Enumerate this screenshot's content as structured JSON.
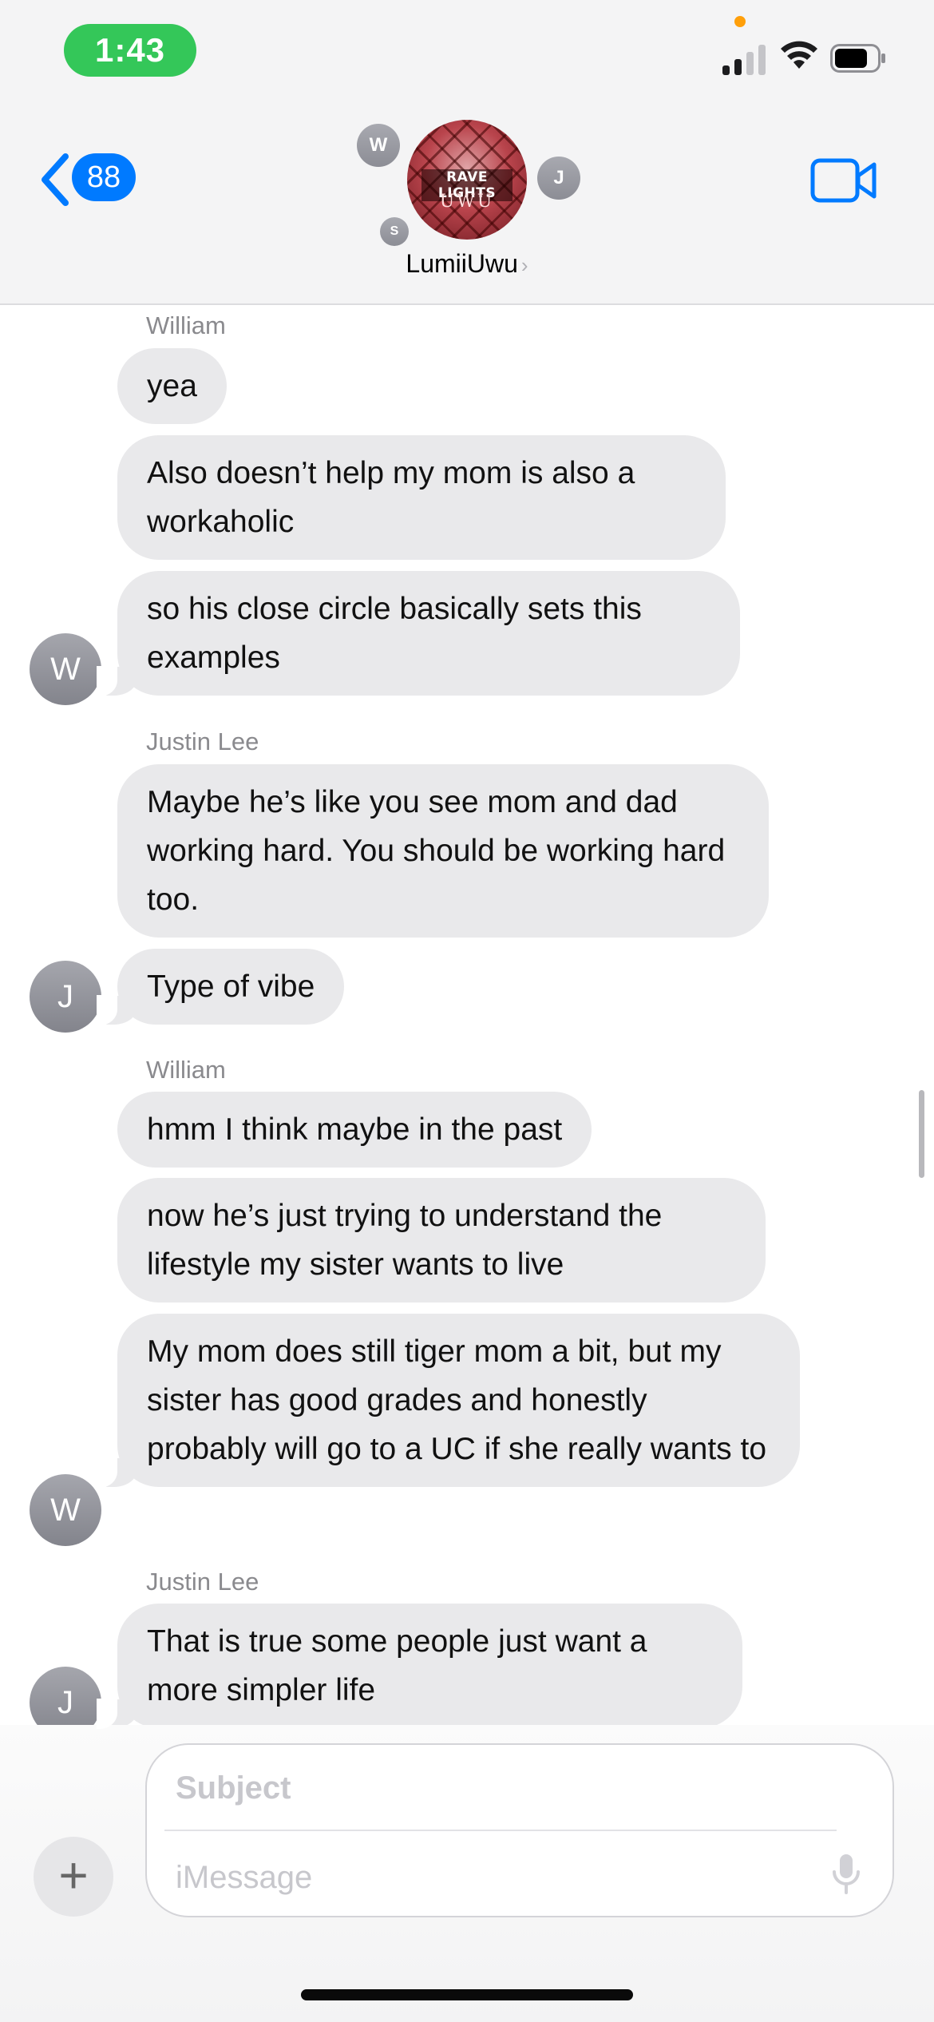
{
  "status_bar": {
    "time": "1:43"
  },
  "header": {
    "back_badge": "88",
    "group_name": "LumiiUwu",
    "group_avatar_text_line1": "RAVE LIGHTS",
    "group_avatar_text_line2": "UWU",
    "member_initials": [
      "W",
      "J",
      "S"
    ]
  },
  "messages": [
    {
      "sender": "William",
      "initial": "W",
      "bubbles": [
        "yea",
        "Also doesn’t help my mom is also a workaholic",
        "so his close circle basically sets this examples"
      ]
    },
    {
      "sender": "Justin Lee",
      "initial": "J",
      "bubbles": [
        "Maybe he’s like you see mom and dad working hard. You should be working hard too.",
        "Type of vibe"
      ]
    },
    {
      "sender": "William",
      "initial": "W",
      "bubbles": [
        "hmm I think maybe in the past",
        "now he’s just trying to understand the lifestyle my sister wants to live",
        "My mom does still tiger mom a bit, but my sister has good grades and honestly probably will go to a UC if she really wants to"
      ]
    },
    {
      "sender": "Justin Lee",
      "initial": "J",
      "bubbles": [
        "That is true some people just want a more simpler life"
      ]
    }
  ],
  "composer": {
    "subject_placeholder": "Subject",
    "message_placeholder": "iMessage",
    "add_button": "+"
  },
  "colors": {
    "accent": "#007aff",
    "bubble_gray": "#e9e9eb",
    "time_pill": "#34c759"
  }
}
